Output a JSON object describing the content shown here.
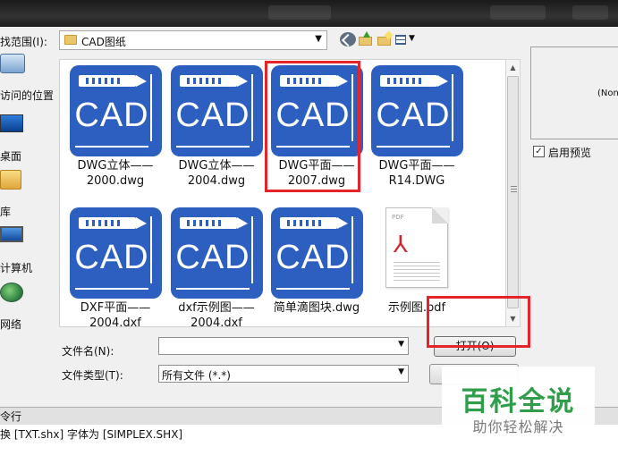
{
  "dialog": {
    "look_in_label": "找范围(I):",
    "look_in_value": "CAD图纸"
  },
  "places": [
    {
      "label": "访问的位置",
      "icon": "recent-places-icon"
    },
    {
      "label": "桌面",
      "icon": "desktop-icon"
    },
    {
      "label": "库",
      "icon": "library-icon"
    },
    {
      "label": "计算机",
      "icon": "computer-icon"
    },
    {
      "label": "网络",
      "icon": "network-icon"
    }
  ],
  "files": [
    {
      "name_line1": "DWG立体——",
      "name_line2": "2000.dwg",
      "type": "cad",
      "icon_text": "CAD"
    },
    {
      "name_line1": "DWG立体——",
      "name_line2": "2004.dwg",
      "type": "cad",
      "icon_text": "CAD"
    },
    {
      "name_line1": "DWG平面——",
      "name_line2": "2007.dwg",
      "type": "cad",
      "icon_text": "CAD",
      "highlighted": true
    },
    {
      "name_line1": "DWG平面——",
      "name_line2": "R14.DWG",
      "type": "cad",
      "icon_text": "CAD"
    },
    {
      "name_line1": "DXF平面——",
      "name_line2": "2004.dxf",
      "type": "cad",
      "icon_text": "CAD"
    },
    {
      "name_line1": "dxf示例图——",
      "name_line2": "2004.dxf",
      "type": "cad",
      "icon_text": "CAD"
    },
    {
      "name_line1": "简单滴图块.dwg",
      "name_line2": "",
      "type": "cad",
      "icon_text": "CAD"
    },
    {
      "name_line1": "示例图.pdf",
      "name_line2": "",
      "type": "pdf",
      "icon_text": "PDF"
    }
  ],
  "preview": {
    "placeholder": "(Non",
    "enable_label": "启用预览",
    "enabled": true,
    "check_glyph": "✓"
  },
  "filename": {
    "label": "文件名(N):",
    "value": ""
  },
  "filetype": {
    "label": "文件类型(T):",
    "value": "所有文件 (*.*)"
  },
  "buttons": {
    "open": "打开(O)"
  },
  "command": {
    "header": "令行",
    "line1": "换 [TXT.shx] 字体为 [SIMPLEX.SHX]"
  },
  "watermark": {
    "title": "百科全说",
    "subtitle": "助你轻松解决"
  },
  "colors": {
    "cad_blue": "#2c5fc0",
    "highlight_red": "#e5232b",
    "watermark_green": "#2f9d4a"
  }
}
